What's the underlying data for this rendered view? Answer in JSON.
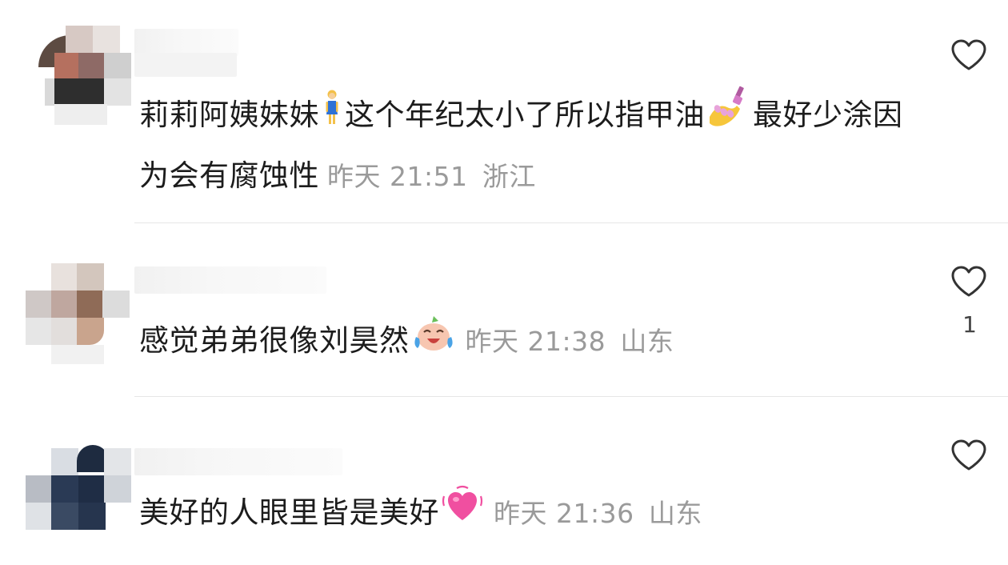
{
  "comments": [
    {
      "text": "莉莉阿姨妹妹",
      "emoji_1": "woman-standing-icon",
      "text_2": "这个年纪太小了所以指甲油",
      "emoji_2": "nail-polish-icon",
      "text_3": "最好少涂因为会有腐蚀性",
      "time": "昨天 21:51",
      "location": "浙江",
      "likes": ""
    },
    {
      "text": "感觉弟弟很像刘昊然",
      "emoji_1": "crying-laughing-face-icon",
      "time": "昨天 21:38",
      "location": "山东",
      "likes": "1"
    },
    {
      "text": "美好的人眼里皆是美好",
      "emoji_1": "growing-heart-icon",
      "time": "昨天 21:36",
      "location": "山东",
      "likes": ""
    }
  ],
  "colors": {
    "text": "#1c1c1c",
    "meta": "#9a9a9a",
    "divider": "#e6e6e6",
    "heart_outline": "#333333"
  }
}
